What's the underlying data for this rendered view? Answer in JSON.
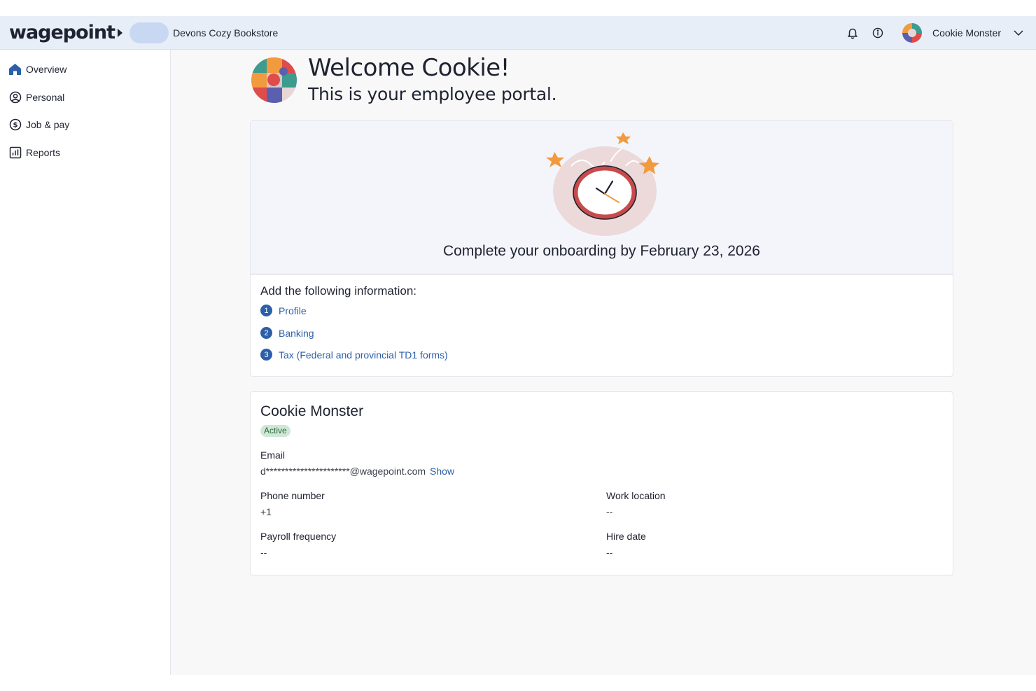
{
  "header": {
    "logo_text": "wagepoint",
    "company_name": "Devons Cozy Bookstore",
    "user_name": "Cookie Monster",
    "icons": [
      "bell-icon",
      "info-icon",
      "chevron-down-icon"
    ]
  },
  "sidebar": {
    "items": [
      {
        "label": "Overview",
        "icon": "home-icon",
        "active": true
      },
      {
        "label": "Personal",
        "icon": "user-circle-icon"
      },
      {
        "label": "Job & pay",
        "icon": "dollar-icon"
      },
      {
        "label": "Reports",
        "icon": "bar-chart-icon"
      }
    ]
  },
  "welcome": {
    "title": "Welcome Cookie!",
    "subtitle": "This is your employee portal."
  },
  "onboarding": {
    "title": "Complete your onboarding by February 23, 2026",
    "heading": "Add the following information:",
    "steps": [
      {
        "num": "1",
        "label": "Profile"
      },
      {
        "num": "2",
        "label": "Banking"
      },
      {
        "num": "3",
        "label": "Tax (Federal and provincial TD1 forms)"
      }
    ]
  },
  "profile": {
    "name": "Cookie Monster",
    "status": "Active",
    "email_label": "Email",
    "email_value": "d**********************@wagepoint.com",
    "email_show": "Show",
    "phone_label": "Phone number",
    "phone_value": "+1",
    "work_location_label": "Work location",
    "work_location_value": "--",
    "payroll_frequency_label": "Payroll frequency",
    "payroll_frequency_value": "--",
    "hire_date_label": "Hire date",
    "hire_date_value": "--"
  },
  "colors": {
    "accent": "#2c5fa8",
    "header_bg": "#e8eef7",
    "badge_bg": "#cfe7d4"
  }
}
